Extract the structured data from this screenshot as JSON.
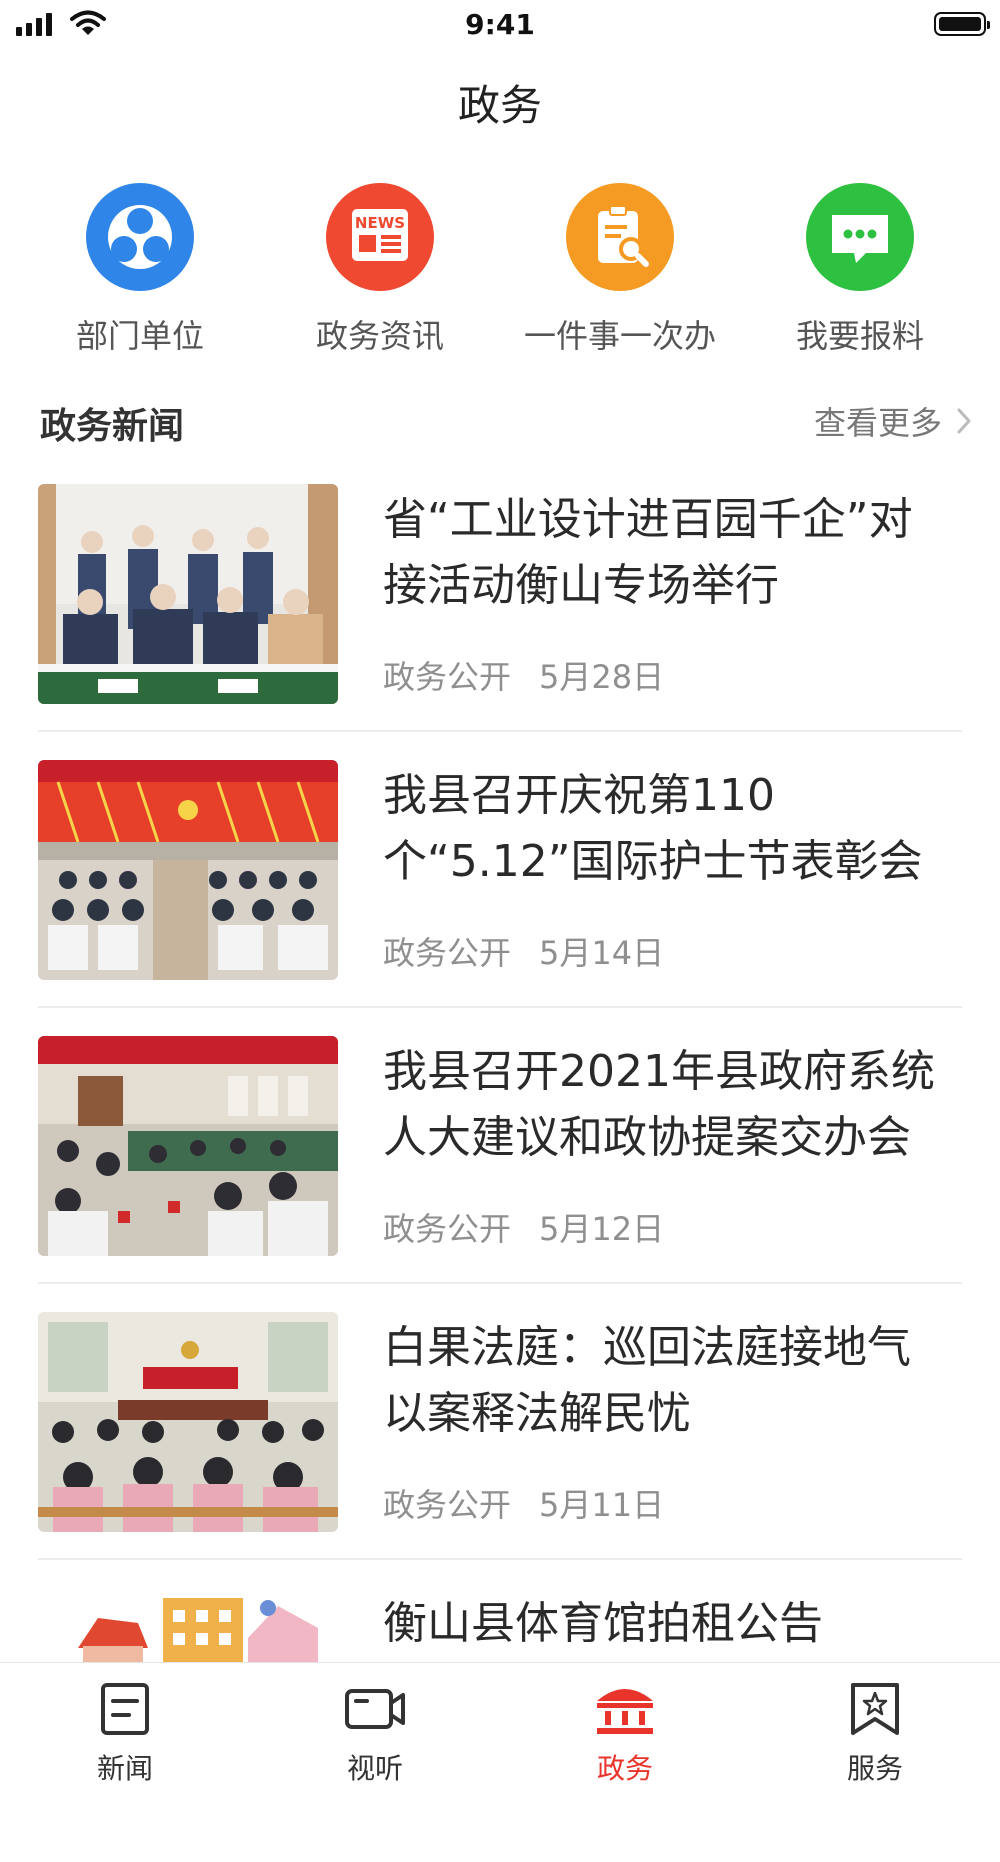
{
  "status_bar": {
    "time": "9:41"
  },
  "page": {
    "title": "政务"
  },
  "quick_entries": [
    {
      "label": "部门单位",
      "icon": "people-group-icon",
      "color": "#2f86e8"
    },
    {
      "label": "政务资讯",
      "icon": "news-icon",
      "color": "#ef4a31"
    },
    {
      "label": "一件事一次办",
      "icon": "clipboard-search-icon",
      "color": "#f59a23"
    },
    {
      "label": "我要报料",
      "icon": "message-bubble-icon",
      "color": "#2ec040"
    }
  ],
  "section": {
    "title": "政务新闻",
    "more_label": "查看更多"
  },
  "news": [
    {
      "title": "省“工业设计进百园千企”对接活动衡山专场举行",
      "source": "政务公开",
      "date": "5月28日"
    },
    {
      "title": "我县召开庆祝第110个“5.12”国际护士节表彰会",
      "source": "政务公开",
      "date": "5月14日"
    },
    {
      "title": "我县召开2021年县政府系统人大建议和政协提案交办会",
      "source": "政务公开",
      "date": "5月12日"
    },
    {
      "title": "白果法庭：巡回法庭接地气以案释法解民忧",
      "source": "政务公开",
      "date": "5月11日"
    },
    {
      "title": "衡山县体育馆拍租公告",
      "source": "",
      "date": ""
    }
  ],
  "tabs": [
    {
      "label": "新闻",
      "icon": "news-doc-icon",
      "active": false
    },
    {
      "label": "视听",
      "icon": "video-camera-icon",
      "active": false
    },
    {
      "label": "政务",
      "icon": "government-building-icon",
      "active": true
    },
    {
      "label": "服务",
      "icon": "bookmark-star-icon",
      "active": false
    }
  ],
  "colors": {
    "accent": "#e8342b",
    "text_primary": "#2a2a2a",
    "text_secondary": "#8f8f8f"
  }
}
